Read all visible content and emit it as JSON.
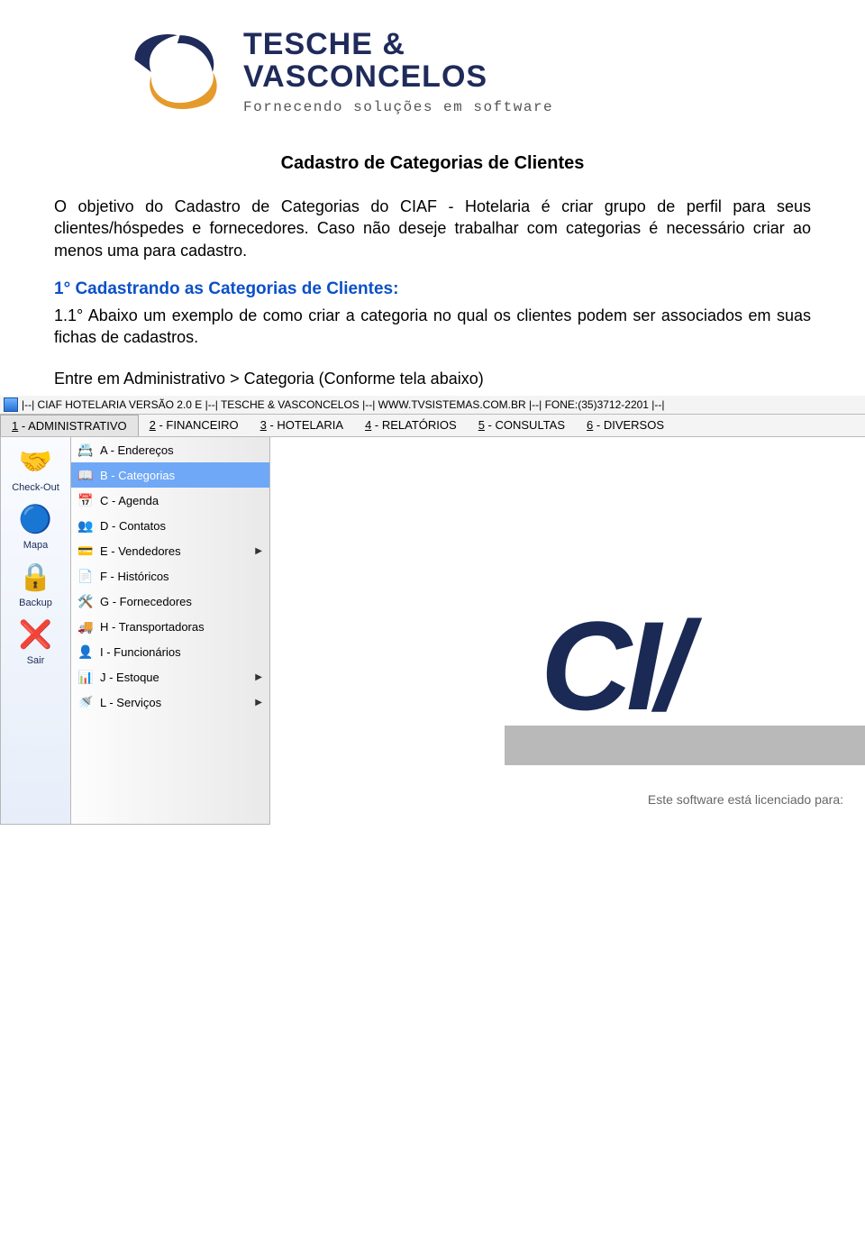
{
  "logo": {
    "brand_line1": "TESCHE &",
    "brand_line2": "VASCONCELOS",
    "tagline": "Fornecendo soluções em software"
  },
  "doc": {
    "title": "Cadastro de Categorias de Clientes",
    "intro": "O objetivo do Cadastro de Categorias do CIAF - Hotelaria é criar grupo de perfil para seus clientes/hóspedes e fornecedores. Caso não deseje trabalhar com categorias é necessário criar ao menos uma para cadastro.",
    "section_heading": "1° Cadastrando as Categorias de Clientes:",
    "section_body": "1.1° Abaixo um exemplo de como criar a categoria no qual os clientes podem ser associados em suas fichas de cadastros.",
    "nav_hint": "Entre em Administrativo > Categoria (Conforme tela abaixo)"
  },
  "app": {
    "title_bar": "|--| CIAF HOTELARIA VERSÃO 2.0 E |--| TESCHE & VASCONCELOS |--| WWW.TVSISTEMAS.COM.BR |--| FONE:(35)3712-2201 |--|",
    "menus": [
      {
        "n": "1",
        "label": "ADMINISTRATIVO",
        "active": true
      },
      {
        "n": "2",
        "label": "FINANCEIRO"
      },
      {
        "n": "3",
        "label": "HOTELARIA"
      },
      {
        "n": "4",
        "label": "RELATÓRIOS"
      },
      {
        "n": "5",
        "label": "CONSULTAS"
      },
      {
        "n": "6",
        "label": "DIVERSOS"
      }
    ],
    "dropdown": [
      {
        "label": "A - Endereços",
        "icon": "📇",
        "icon_name": "address-icon"
      },
      {
        "label": "B - Categorias",
        "icon": "📖",
        "icon_name": "book-icon",
        "selected": true
      },
      {
        "label": "C - Agenda",
        "icon": "📅",
        "icon_name": "calendar-icon"
      },
      {
        "label": "D - Contatos",
        "icon": "👥",
        "icon_name": "people-icon"
      },
      {
        "label": "E - Vendedores",
        "icon": "💳",
        "icon_name": "card-icon",
        "caret": true
      },
      {
        "label": "F - Históricos",
        "icon": "📄",
        "icon_name": "document-icon"
      },
      {
        "label": "G - Fornecedores",
        "icon": "🛠️",
        "icon_name": "tools-icon"
      },
      {
        "label": "H - Transportadoras",
        "icon": "🚚",
        "icon_name": "truck-icon"
      },
      {
        "label": "I - Funcionários",
        "icon": "👤",
        "icon_name": "person-icon"
      },
      {
        "label": "J - Estoque",
        "icon": "📊",
        "icon_name": "stock-icon",
        "caret": true
      },
      {
        "label": "L - Serviços",
        "icon": "🚿",
        "icon_name": "services-icon",
        "caret": true
      }
    ],
    "side_tools": [
      {
        "label": "Check-Out",
        "glyph": "🤝",
        "icon_name": "checkout-icon"
      },
      {
        "label": "Mapa",
        "glyph": "🔵",
        "icon_name": "map-icon"
      },
      {
        "label": "Backup",
        "glyph": "🔒",
        "icon_name": "backup-icon"
      },
      {
        "label": "Sair",
        "glyph": "❌",
        "icon_name": "exit-icon"
      }
    ],
    "license_text": "Este software está licenciado para:"
  }
}
